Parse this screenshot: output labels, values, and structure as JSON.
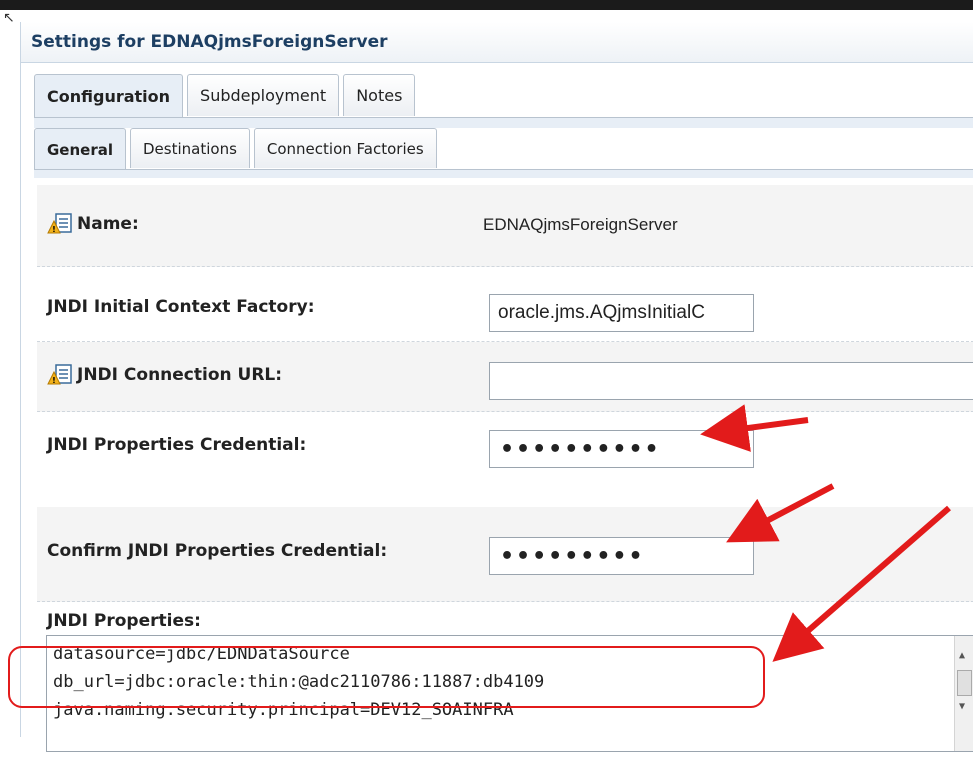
{
  "window": {
    "title": "Settings for EDNAQjmsForeignServer"
  },
  "tabs_primary": [
    {
      "label": "Configuration",
      "active": true
    },
    {
      "label": "Subdeployment",
      "active": false
    },
    {
      "label": "Notes",
      "active": false
    }
  ],
  "tabs_secondary": [
    {
      "label": "General",
      "active": true
    },
    {
      "label": "Destinations",
      "active": false
    },
    {
      "label": "Connection Factories",
      "active": false
    }
  ],
  "form": {
    "name": {
      "label": "Name:",
      "value": "EDNAQjmsForeignServer"
    },
    "initial_context_factory": {
      "label": "JNDI Initial Context Factory:",
      "value": "oracle.jms.AQjmsInitialC"
    },
    "connection_url": {
      "label": "JNDI Connection URL:",
      "value": ""
    },
    "properties_credential": {
      "label": "JNDI Properties Credential:",
      "value": "••••••••••"
    },
    "confirm_properties_credential": {
      "label": "Confirm JNDI Properties Credential:",
      "value": "•••••••••"
    },
    "properties": {
      "label": "JNDI Properties:",
      "lines": [
        "datasource=jdbc/EDNDataSource",
        "db_url=jdbc:oracle:thin:@adc2110786:11887:db4109",
        "java.naming.security.principal=DEV12_SOAINFRA"
      ]
    }
  },
  "annotation_color": "#e21b1b",
  "icons": [
    "info-warning-icon",
    "scroll-up-icon",
    "scroll-down-icon"
  ]
}
